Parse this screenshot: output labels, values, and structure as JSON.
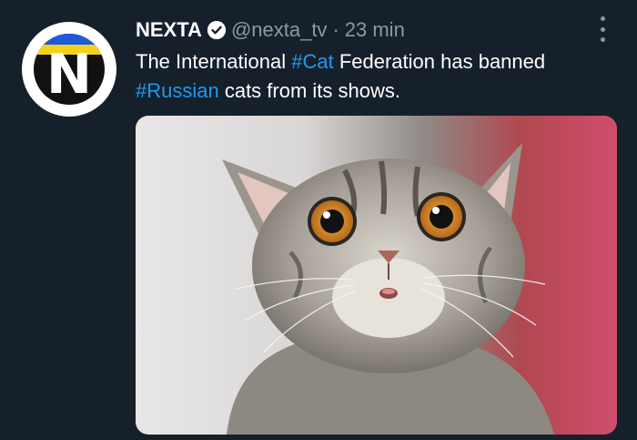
{
  "tweet": {
    "author": {
      "name": "NEXTA",
      "avatar_letter": "N",
      "handle": "@nexta_tv",
      "separator": "·",
      "time": "23 min"
    },
    "text": {
      "part1": "The International ",
      "hashtag1": "#Cat",
      "part2": " Federation has banned ",
      "hashtag2": "#Russian",
      "part3": " cats from its shows."
    },
    "media": {
      "icon": "cat-photo"
    },
    "colors": {
      "background": "#15202b",
      "link": "#1d9bf0",
      "secondary_text": "#8b98a5",
      "primary_text": "#ffffff"
    }
  }
}
